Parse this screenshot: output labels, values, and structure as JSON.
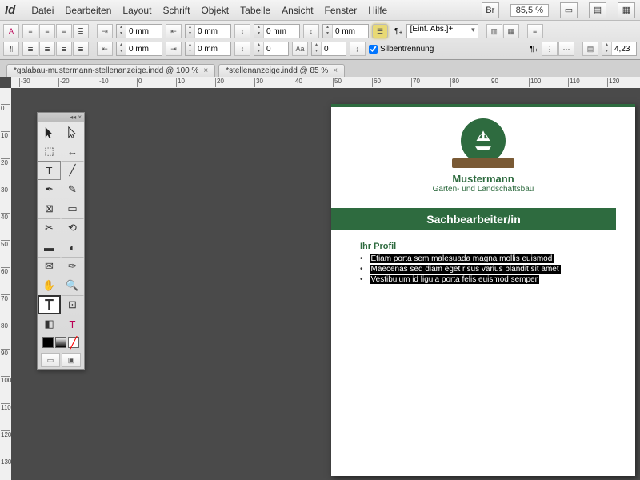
{
  "app": {
    "logo": "Id"
  },
  "menu": [
    "Datei",
    "Bearbeiten",
    "Layout",
    "Schrift",
    "Objekt",
    "Tabelle",
    "Ansicht",
    "Fenster",
    "Hilfe"
  ],
  "top_right": {
    "br": "Br",
    "zoom": "85,5 %"
  },
  "ctrl": {
    "left_indent": "0 mm",
    "right_indent": "0 mm",
    "first_line": "0 mm",
    "last_line": "0 mm",
    "space_before": "0 mm",
    "space_after": "0 mm",
    "dropcap_lines": "0",
    "dropcap_chars": "0",
    "baseline1": "0 mm",
    "baseline2": "0 mm",
    "auto_nr": "0",
    "para_style": "[Einf. Abs.]+",
    "hyphenation": "Silbentrennung",
    "num2": "4,23"
  },
  "tabs": [
    {
      "title": "*galabau-mustermann-stellenanzeige.indd @ 100 %"
    },
    {
      "title": "*stellenanzeige.indd @ 85 %"
    }
  ],
  "hruler_ticks": [
    -30,
    -20,
    -10,
    0,
    10,
    20,
    30,
    40,
    50,
    60,
    70,
    80,
    90,
    100,
    110,
    120
  ],
  "vruler_ticks": [
    0,
    10,
    20,
    30,
    40,
    50,
    60,
    70,
    80,
    90,
    100,
    110,
    120,
    130
  ],
  "doc": {
    "company": "Mustermann",
    "tagline": "Garten- und Landschaftsbau",
    "banner": "Sachbearbeiter/in",
    "section_title": "Ihr Profil",
    "bullets": [
      "Etiam porta sem malesuada magna mollis euismod",
      "Maecenas sed diam eget risus varius blandit sit amet",
      "Vestibulum id ligula porta felis euismod semper"
    ]
  }
}
